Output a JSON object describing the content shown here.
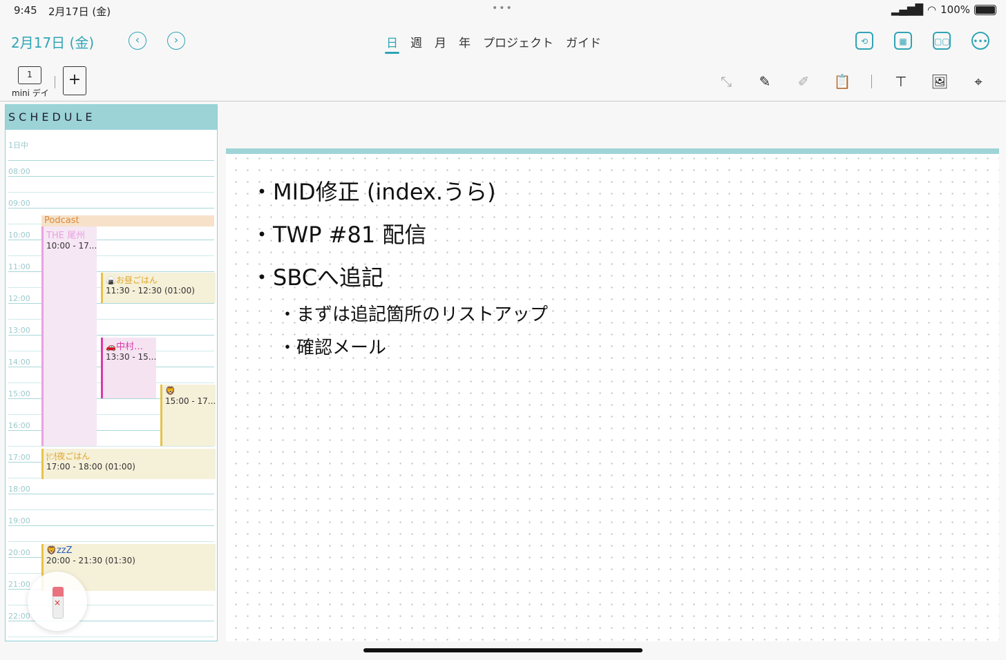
{
  "status": {
    "time": "9:45",
    "date": "2月17日 (金)",
    "battery": "100%"
  },
  "nav": {
    "date_title": "2月17日 (金)",
    "prev_label": "‹",
    "next_label": "›",
    "tabs": [
      {
        "label": "日",
        "active": true
      },
      {
        "label": "週"
      },
      {
        "label": "月"
      },
      {
        "label": "年"
      },
      {
        "label": "プロジェクト"
      },
      {
        "label": "ガイド"
      }
    ]
  },
  "toolbar": {
    "page_number": "1",
    "page_label": "mini デイ",
    "add_label": "+"
  },
  "schedule": {
    "title": "SCHEDULE",
    "allday_label": "1日中",
    "hours": [
      "08:00",
      "09:00",
      "10:00",
      "11:00",
      "12:00",
      "13:00",
      "14:00",
      "15:00",
      "16:00",
      "17:00",
      "18:00",
      "19:00",
      "20:00",
      "21:00",
      "22:00"
    ],
    "events": [
      {
        "title": "Podcast",
        "sub": "THE 尾州",
        "time": "10:00 - 17..."
      },
      {
        "title": "お昼ごはん",
        "time": "11:30 - 12:30 (01:00)"
      },
      {
        "title": "中村…",
        "time": "13:30 - 15..."
      },
      {
        "title": "",
        "time": "15:00 - 17..."
      },
      {
        "title": "夜ごはん",
        "time": "17:00 - 18:00 (01:00)"
      },
      {
        "title": "zzZ",
        "time": "20:00 - 21:30 (01:30)"
      }
    ]
  },
  "note": {
    "lines": [
      "・MID修正 (index.うら)",
      "・TWP #81 配信",
      "・SBCへ追記",
      "・まずは追記箇所のリストアップ",
      "・確認メール"
    ]
  },
  "colors": {
    "accent": "#2fa4b5",
    "schedule_header": "#9bd3d7",
    "podcast": "#e7a2e0",
    "food": "#e6c24a",
    "car": "#d93aa6"
  }
}
